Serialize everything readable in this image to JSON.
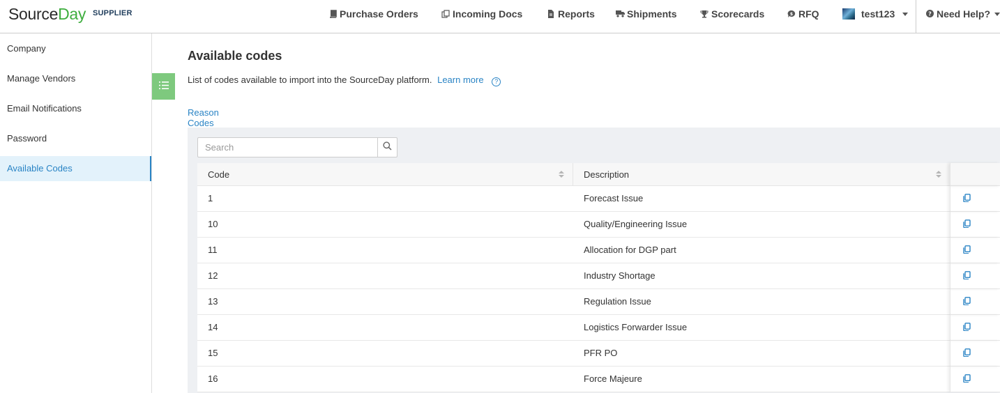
{
  "brand": {
    "name_a": "Source",
    "name_b": "Day",
    "role": "SUPPLIER"
  },
  "nav": {
    "purchase_orders": "Purchase Orders",
    "incoming_docs": "Incoming Docs",
    "reports": "Reports",
    "shipments": "Shipments",
    "scorecards": "Scorecards",
    "rfq": "RFQ",
    "user": "test123",
    "help": "Need Help?"
  },
  "sidebar": {
    "items": [
      {
        "label": "Company"
      },
      {
        "label": "Manage Vendors"
      },
      {
        "label": "Email Notifications"
      },
      {
        "label": "Password"
      },
      {
        "label": "Available Codes"
      }
    ]
  },
  "main": {
    "title": "Available codes",
    "subtitle": "List of codes available to import into the SourceDay platform.",
    "learn_more": "Learn more",
    "tab": "Reason Codes",
    "search_placeholder": "Search",
    "columns": {
      "code": "Code",
      "description": "Description"
    },
    "rows": [
      {
        "code": "1",
        "description": "Forecast Issue"
      },
      {
        "code": "10",
        "description": "Quality/Engineering Issue"
      },
      {
        "code": "11",
        "description": "Allocation for DGP part"
      },
      {
        "code": "12",
        "description": "Industry Shortage"
      },
      {
        "code": "13",
        "description": "Regulation Issue"
      },
      {
        "code": "14",
        "description": "Logistics Forwarder Issue"
      },
      {
        "code": "15",
        "description": "PFR PO"
      },
      {
        "code": "16",
        "description": "Force Majeure"
      }
    ]
  },
  "colors": {
    "accent": "#2a84c5",
    "brand_green": "#3fae3f",
    "toggle_green": "#7ec97e"
  }
}
